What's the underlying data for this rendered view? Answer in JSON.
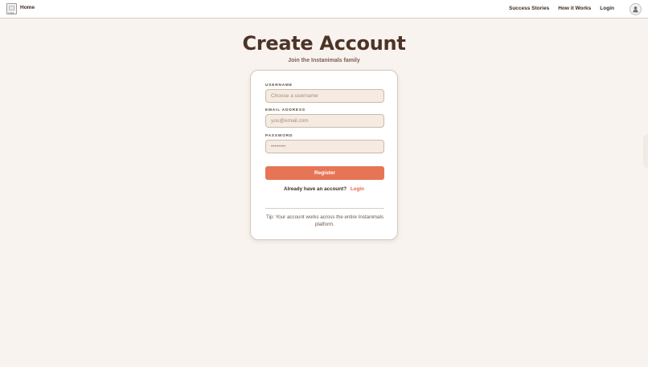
{
  "topbar": {
    "logo_alt": "Insta",
    "home_label": "Home",
    "nav_items": [
      {
        "label": "Success Stories"
      },
      {
        "label": "How it Works"
      },
      {
        "label": "Login"
      }
    ]
  },
  "page": {
    "title": "Create Account",
    "subtitle": "Join the Instanimals family"
  },
  "form": {
    "username": {
      "label": "USERNAME",
      "placeholder": "Choose a username",
      "value": ""
    },
    "email": {
      "label": "EMAIL ADDRESS",
      "placeholder": "you@email.com",
      "value": ""
    },
    "password": {
      "label": "PASSWORD",
      "placeholder": "••••••••",
      "value": ""
    },
    "register_label": "Register",
    "login_prompt": "Already have an account?",
    "login_link": "Login",
    "tip": "Tip: Your account works across the entire Instanimals platform."
  },
  "colors": {
    "background": "#f8f3ee",
    "accent": "#e67556",
    "text": "#4a3428"
  },
  "icons": {
    "logo": "broken-image-icon",
    "avatar": "user-icon"
  }
}
